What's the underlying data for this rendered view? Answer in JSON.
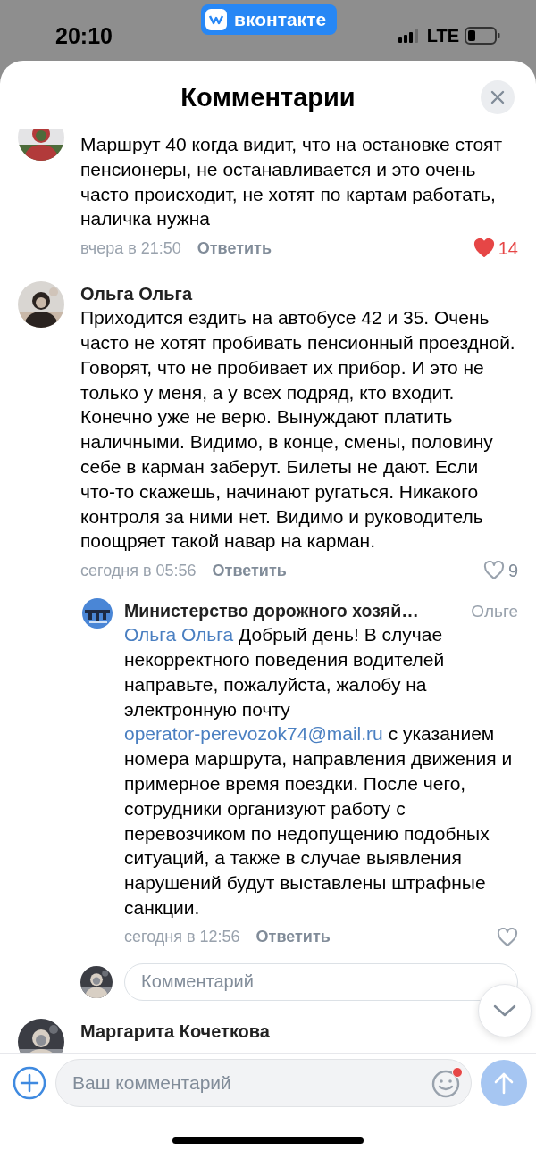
{
  "status_bar": {
    "time": "20:10",
    "app_badge": "вконтакте",
    "network": "LTE"
  },
  "sheet": {
    "title": "Комментарии"
  },
  "comments": [
    {
      "text": "Маршрут 40 когда видит, что на остановке стоят пенсионеры, не останавливается и это очень часто происходит, не хотят по картам работать, наличка нужна",
      "time": "вчера в 21:50",
      "reply_label": "Ответить",
      "liked": true,
      "likes": "14"
    },
    {
      "author": "Ольга Ольга",
      "text": "Приходится ездить на автобусе 42 и 35. Очень часто не хотят пробивать пенсионный проездной. Говорят, что не пробивает их прибор. И это не только у меня, а у всех подряд, кто входит. Конечно уже не верю. Вынуждают платить наличными. Видимо, в конце, смены, половину себе в карман заберут. Билеты не дают. Если что-то скажешь, начинают ругаться. Никакого контроля за ними нет. Видимо и руководитель поощряет такой навар на карман.",
      "time": "сегодня в 05:56",
      "reply_label": "Ответить",
      "liked": false,
      "likes": "9",
      "replies": [
        {
          "avatar": {
            "kind": "logo"
          },
          "author": "Министерство дорожного хозяй…",
          "addressee": "Ольге",
          "segments": [
            {
              "kind": "mention",
              "text": "Ольга Ольга"
            },
            {
              "kind": "text",
              "text": " Добрый день! В случае некорректного поведения водителей направьте, пожалуйста, жалобу на электронную почту "
            },
            {
              "kind": "link",
              "text": "operator-perevozok74@mail.ru"
            },
            {
              "kind": "text",
              "text": " с указанием номера маршрута, направления движения и примерное время поездки. После чего, сотрудники организуют работу с перевозчиком по недопущению подобных ситуаций, а также в случае выявления нарушений будут выставлены штрафные санкции."
            }
          ],
          "time": "сегодня в 12:56",
          "reply_label": "Ответить",
          "liked": false
        }
      ],
      "reply_field": {
        "placeholder": "Комментарий"
      }
    },
    {
      "author": "Маргарита Кочеткова"
    }
  ],
  "composer": {
    "placeholder": "Ваш комментарий",
    "emoji_notification": true
  }
}
